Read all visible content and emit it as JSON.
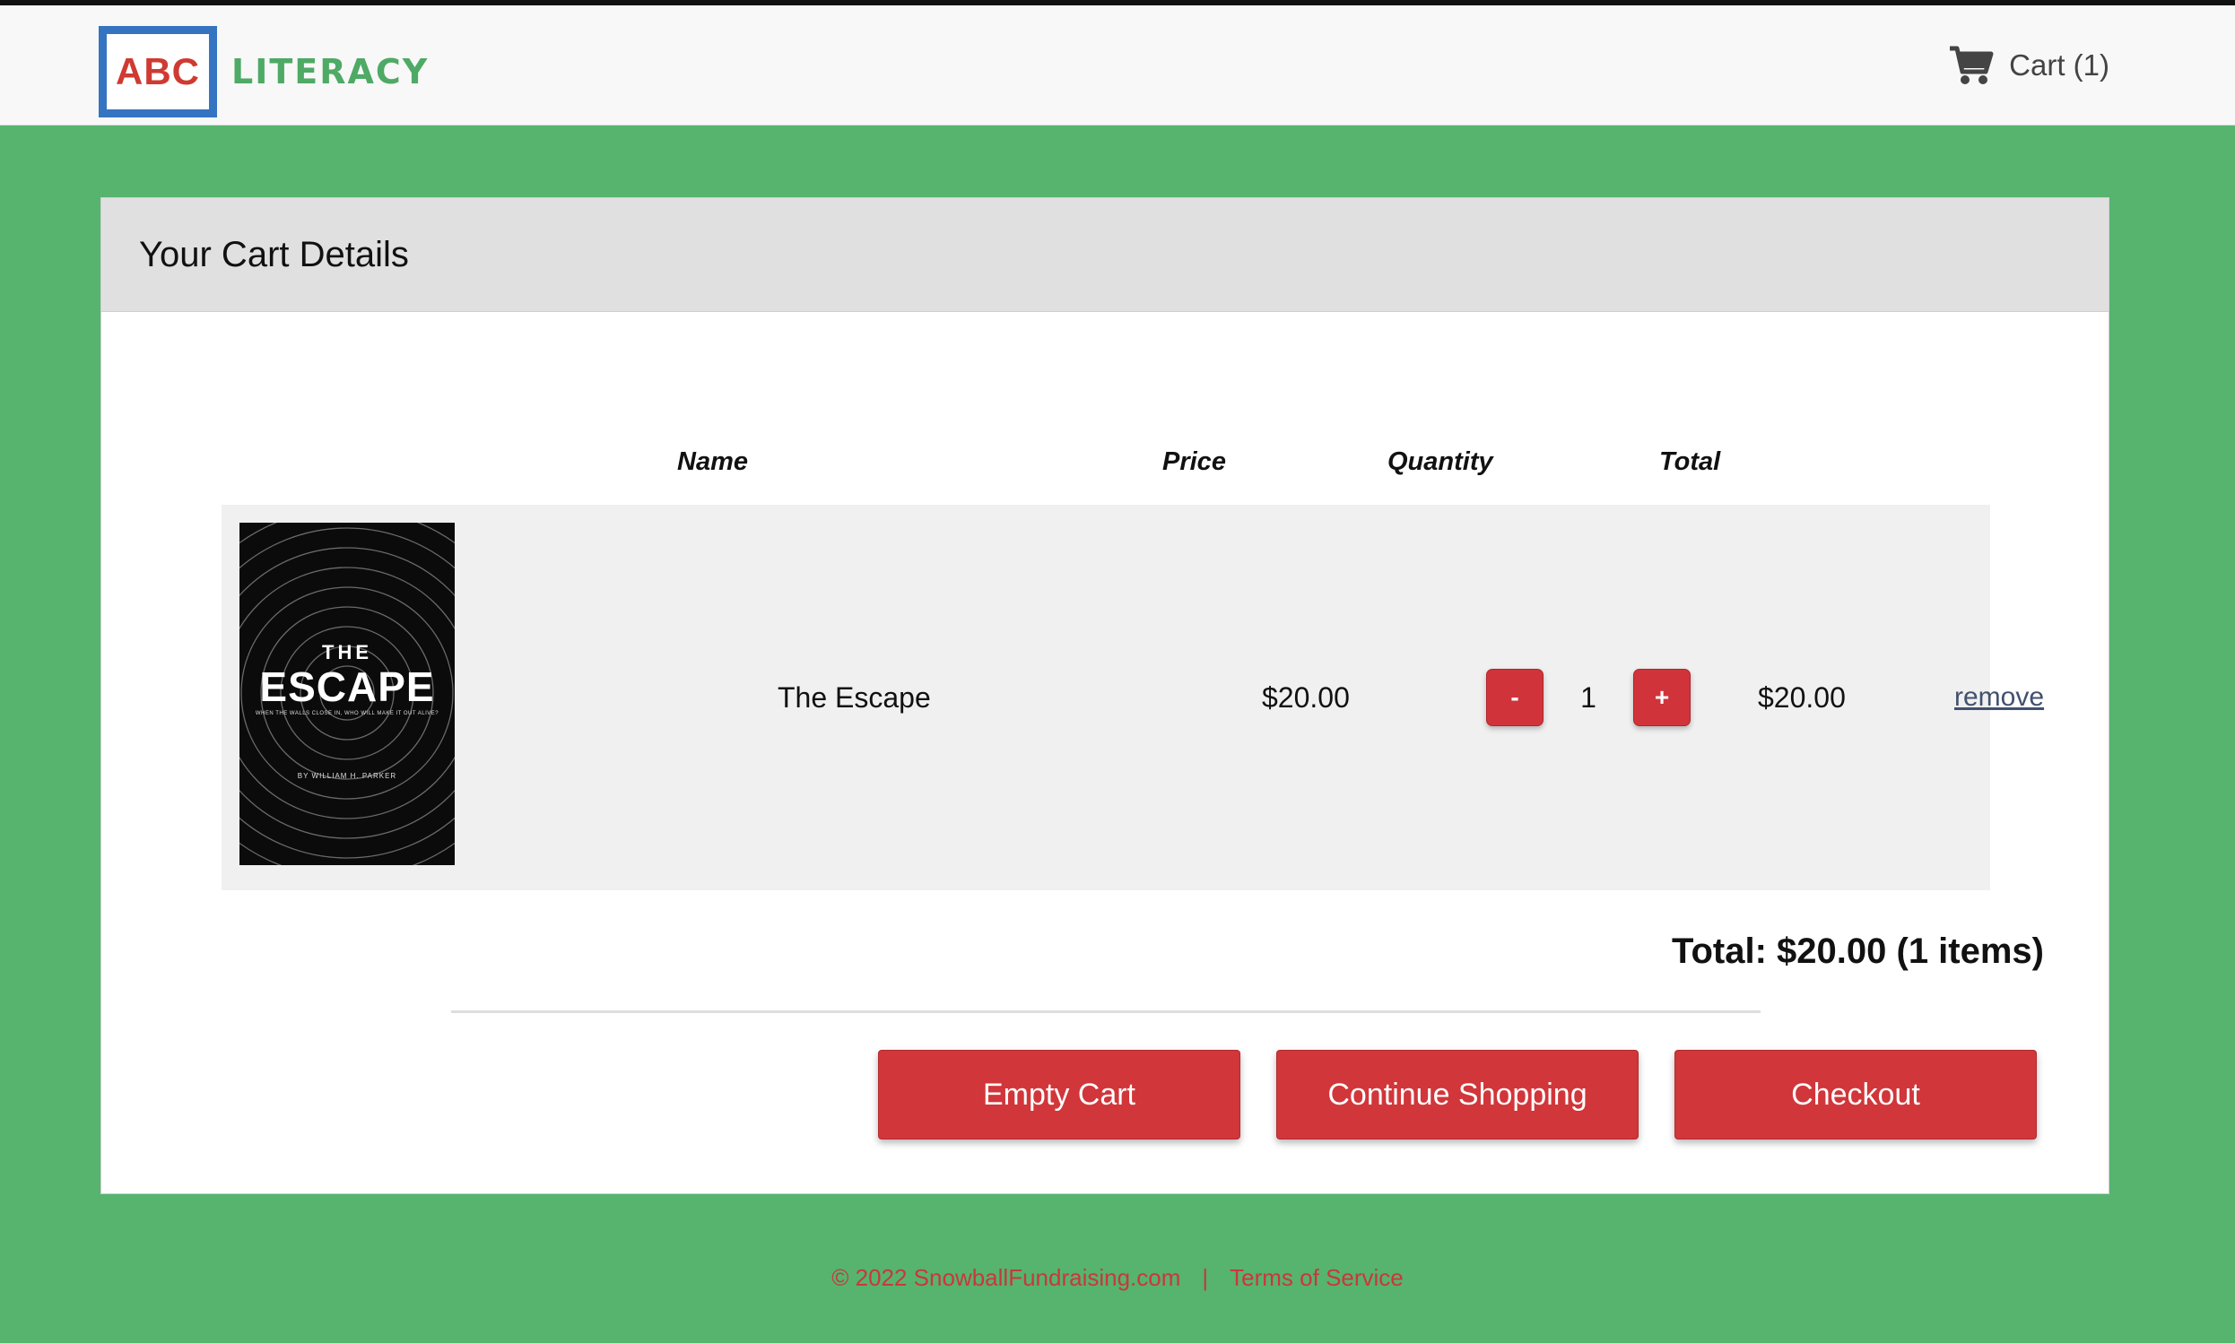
{
  "header": {
    "logo_abc": "ABC",
    "logo_word": "LITERACY",
    "cart_label": "Cart (1)"
  },
  "panel": {
    "title": "Your Cart Details",
    "columns": [
      "Name",
      "Price",
      "Quantity",
      "Total"
    ]
  },
  "items": [
    {
      "cover": {
        "the": "THE",
        "title": "ESCAPE",
        "tagline": "WHEN THE WALLS CLOSE IN, WHO WILL MAKE IT OUT ALIVE?",
        "author": "BY WILLIAM H. PARKER"
      },
      "name": "The Escape",
      "price": "$20.00",
      "decrement_label": "-",
      "quantity": "1",
      "increment_label": "+",
      "total": "$20.00",
      "remove_label": "remove"
    }
  ],
  "summary": {
    "total_text": "Total: $20.00 (1 items)"
  },
  "actions": {
    "empty_cart": "Empty Cart",
    "continue_shopping": "Continue Shopping",
    "checkout": "Checkout"
  },
  "footer": {
    "copyright": "© 2022 SnowballFundraising.com",
    "separator": "|",
    "terms": "Terms of Service"
  },
  "colors": {
    "background_green": "#56b46f",
    "button_red": "#d1363a",
    "logo_blue": "#3574c1",
    "logo_green": "#4eaa65"
  }
}
